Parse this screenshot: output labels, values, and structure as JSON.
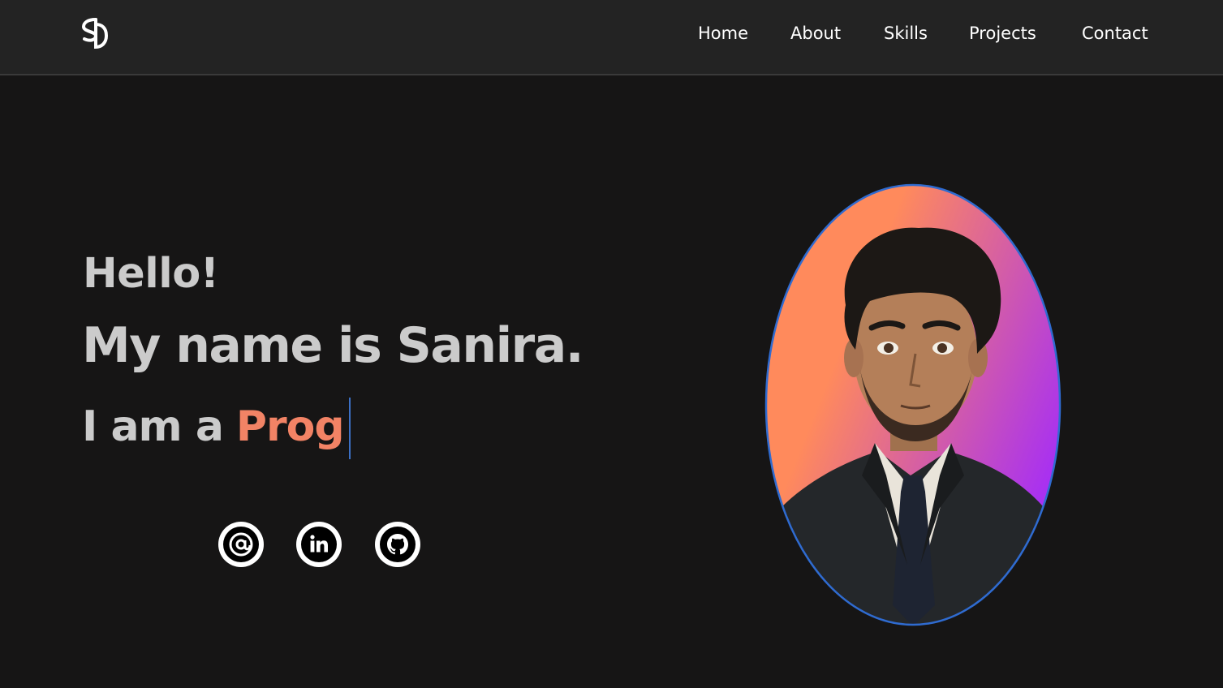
{
  "brand": {
    "logo_icon": "sd-monogram-logo",
    "logo_text": "SD"
  },
  "nav": {
    "items": [
      {
        "label": "Home"
      },
      {
        "label": "About"
      },
      {
        "label": "Skills"
      },
      {
        "label": "Projects"
      },
      {
        "label": "Contact"
      }
    ]
  },
  "hero": {
    "greeting": "Hello!",
    "intro": "My name is Sanira.",
    "role_prefix": "I am a",
    "role_typed": "Prog"
  },
  "socials": [
    {
      "icon": "at-email-icon"
    },
    {
      "icon": "linkedin-icon"
    },
    {
      "icon": "github-icon"
    }
  ],
  "colors": {
    "navbar_bg": "#232323",
    "page_bg": "#161515",
    "accent": "#f28365",
    "text": "#cbcbcb",
    "cursor": "#3b6fc4",
    "portrait_gradient_start": "#ff8a5c",
    "portrait_gradient_end": "#a931f0"
  }
}
